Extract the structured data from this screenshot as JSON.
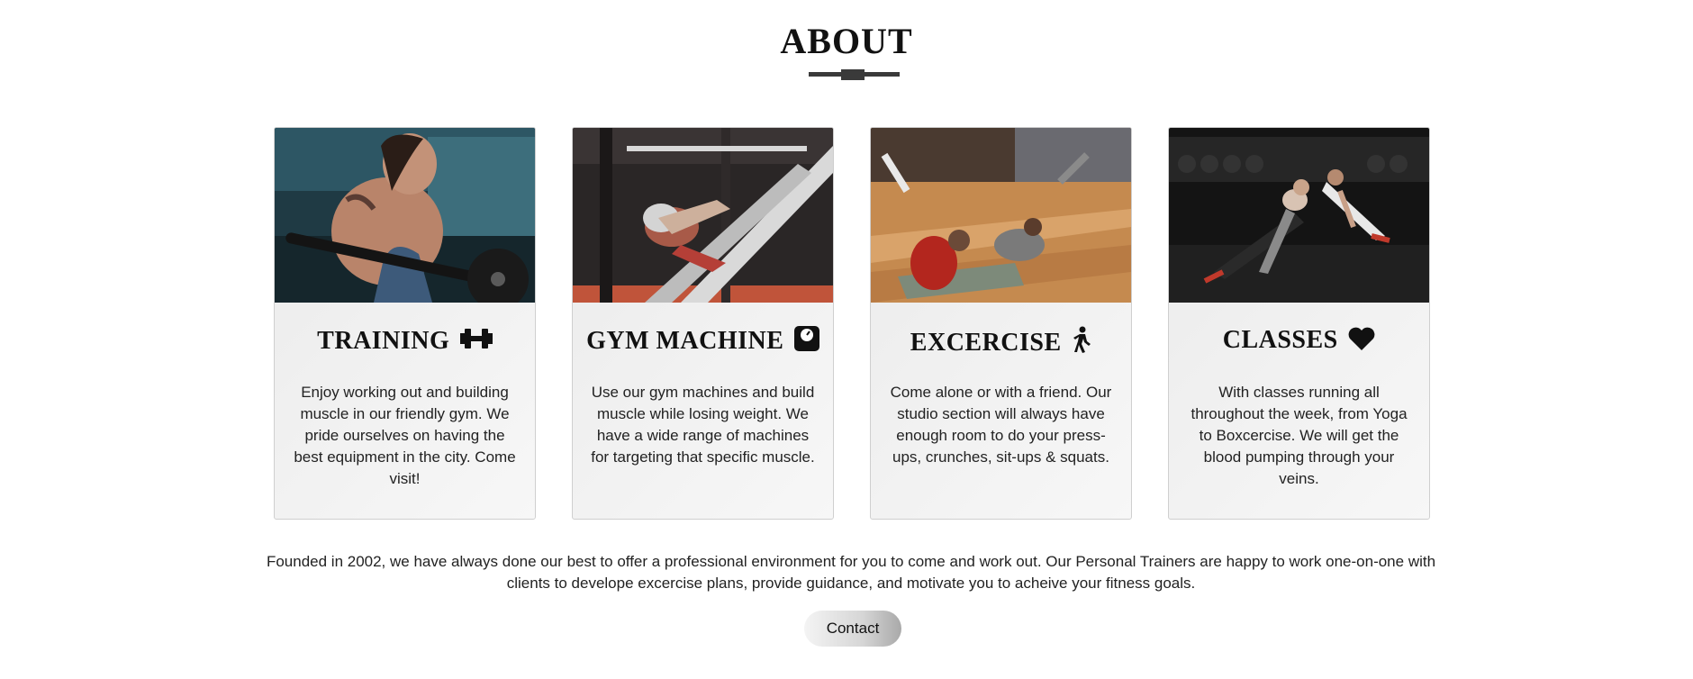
{
  "section": {
    "title": "ABOUT"
  },
  "cards": [
    {
      "title": "TRAINING",
      "icon": "dumbbell-icon",
      "text": "Enjoy working out and building muscle in our friendly gym. We pride ourselves on having the best equipment in the city. Come visit!",
      "image": "woman-training-photo"
    },
    {
      "title": "GYM MACHINE",
      "icon": "scale-icon",
      "text": "Use our gym machines and build muscle while losing weight. We have a wide range of machines for targeting that specific muscle.",
      "image": "leg-press-machine-photo"
    },
    {
      "title": "EXCERCISE",
      "icon": "walking-person-icon",
      "text": "Come alone or with a friend. Our studio section will always have enough room to do your press-ups, crunches, sit-ups & squats.",
      "image": "studio-stretching-photo"
    },
    {
      "title": "CLASSES",
      "icon": "heart-icon",
      "text": "With classes running all throughout the week, from Yoga to Boxcercise. We will get the blood pumping through your veins.",
      "image": "group-class-photo"
    }
  ],
  "about": {
    "text": "Founded in 2002, we have always done our best to offer a professional environment for you to come and work out. Our Personal Trainers are happy to work one-on-one with clients to develope excercise plans, provide guidance, and motivate you to acheive your fitness goals."
  },
  "contact": {
    "label": "Contact"
  },
  "colors": {
    "divider": "#3a3a3a",
    "card_background": "#f2f2f2",
    "text": "#222222"
  }
}
